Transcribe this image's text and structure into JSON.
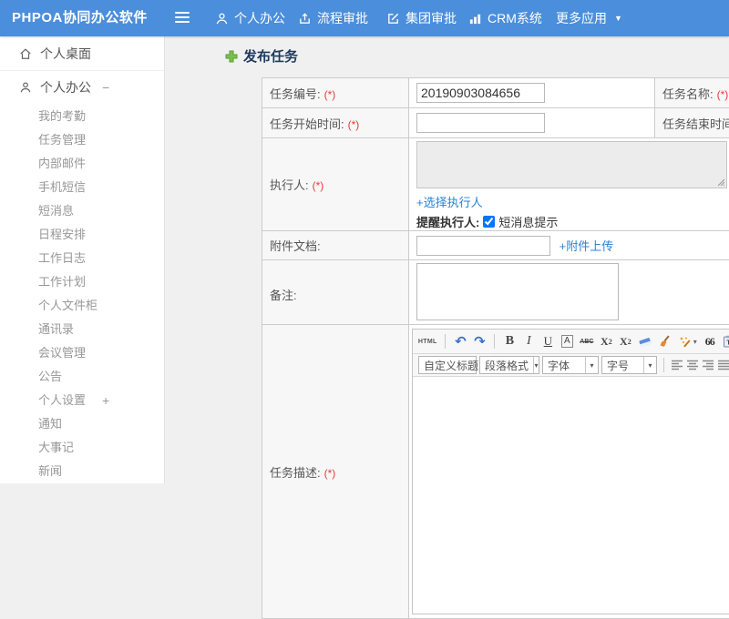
{
  "topbar": {
    "logo": "PHPOA协同办公软件",
    "nav": [
      {
        "label": "个人办公"
      },
      {
        "label": "流程审批"
      },
      {
        "label": "集团审批"
      },
      {
        "label": "CRM系统"
      },
      {
        "label": "更多应用"
      }
    ]
  },
  "sidebar": {
    "items": [
      {
        "label": "个人桌面"
      },
      {
        "label": "个人办公",
        "toggle": "−"
      },
      {
        "label": "我的考勤"
      },
      {
        "label": "任务管理"
      },
      {
        "label": "内部邮件"
      },
      {
        "label": "手机短信"
      },
      {
        "label": "短消息"
      },
      {
        "label": "日程安排"
      },
      {
        "label": "工作日志"
      },
      {
        "label": "工作计划"
      },
      {
        "label": "个人文件柜"
      },
      {
        "label": "通讯录"
      },
      {
        "label": "会议管理"
      },
      {
        "label": "公告"
      },
      {
        "label": "个人设置",
        "toggle": "+"
      },
      {
        "label": "通知"
      },
      {
        "label": "大事记"
      },
      {
        "label": "新闻"
      }
    ]
  },
  "main": {
    "page_title": "发布任务",
    "required_mark": "(*)",
    "form": {
      "task_no_label": "任务编号:",
      "task_no_value": "20190903084656",
      "task_name_label": "任务名称:",
      "start_time_label": "任务开始时间:",
      "end_time_label": "任务结束时间:",
      "executor_label": "执行人:",
      "choose_executor_link": "+选择执行人",
      "remind_executor_label": "提醒执行人:",
      "sms_hint_label": "短消息提示",
      "attachment_label": "附件文档:",
      "attachment_upload_link": "+附件上传",
      "remark_label": "备注:",
      "task_desc_label": "任务描述:"
    },
    "editor": {
      "source_button": "HTML",
      "undo_glyph": "↶",
      "redo_glyph": "↷",
      "bold_glyph": "B",
      "italic_glyph": "I",
      "underline_glyph": "U",
      "fontbox_glyph": "A",
      "strike_glyph": "ABC",
      "sup_glyph": "X",
      "sup_small": "2",
      "sub_glyph": "X",
      "sub_small": "2",
      "quote_glyph": "66",
      "forecolor_glyph": "A",
      "heading_select": "自定义标题",
      "paragraph_select": "段落格式",
      "font_select": "字体",
      "size_select": "字号"
    }
  },
  "colors": {
    "topbar_blue": "#4b8edb",
    "link_blue": "#2a82d4",
    "required_red": "#e53b3b",
    "title_navy": "#1d3a5f",
    "plus_green": "#7cbf4d"
  }
}
